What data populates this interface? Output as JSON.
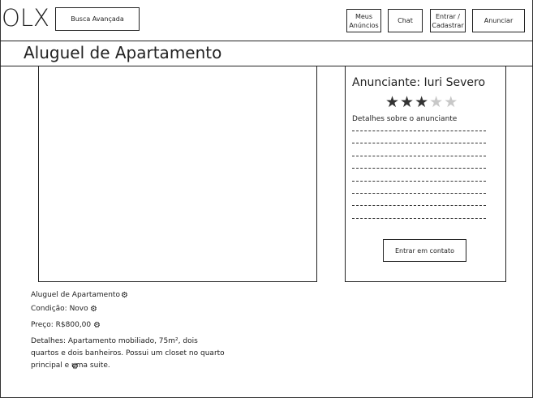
{
  "header": {
    "logo": "OLX",
    "search_button": "Busca Avançada",
    "nav": {
      "my_ads": "Meus\nAnúncios",
      "chat": "Chat",
      "login": "Entrar /\nCadastrar",
      "post_ad": "Anunciar"
    }
  },
  "page": {
    "title": "Aluguel de Apartamento"
  },
  "seller": {
    "name": "Anunciante: Iuri Severo",
    "rating": 3,
    "rating_max": 5,
    "details_label": "Detalhes sobre o anunciante",
    "contact_button": "Entrar em contato"
  },
  "listing": {
    "title": "Aluguel de Apartamento",
    "condition": "Condição: Novo",
    "price": "Preço: R$800,00",
    "details": "Detalhes: Apartamento mobiliado, 75m², dois quartos e dois banheiros. Possui um closet no quarto principal e uma suite."
  },
  "icons": {
    "edit": "gear-icon"
  }
}
